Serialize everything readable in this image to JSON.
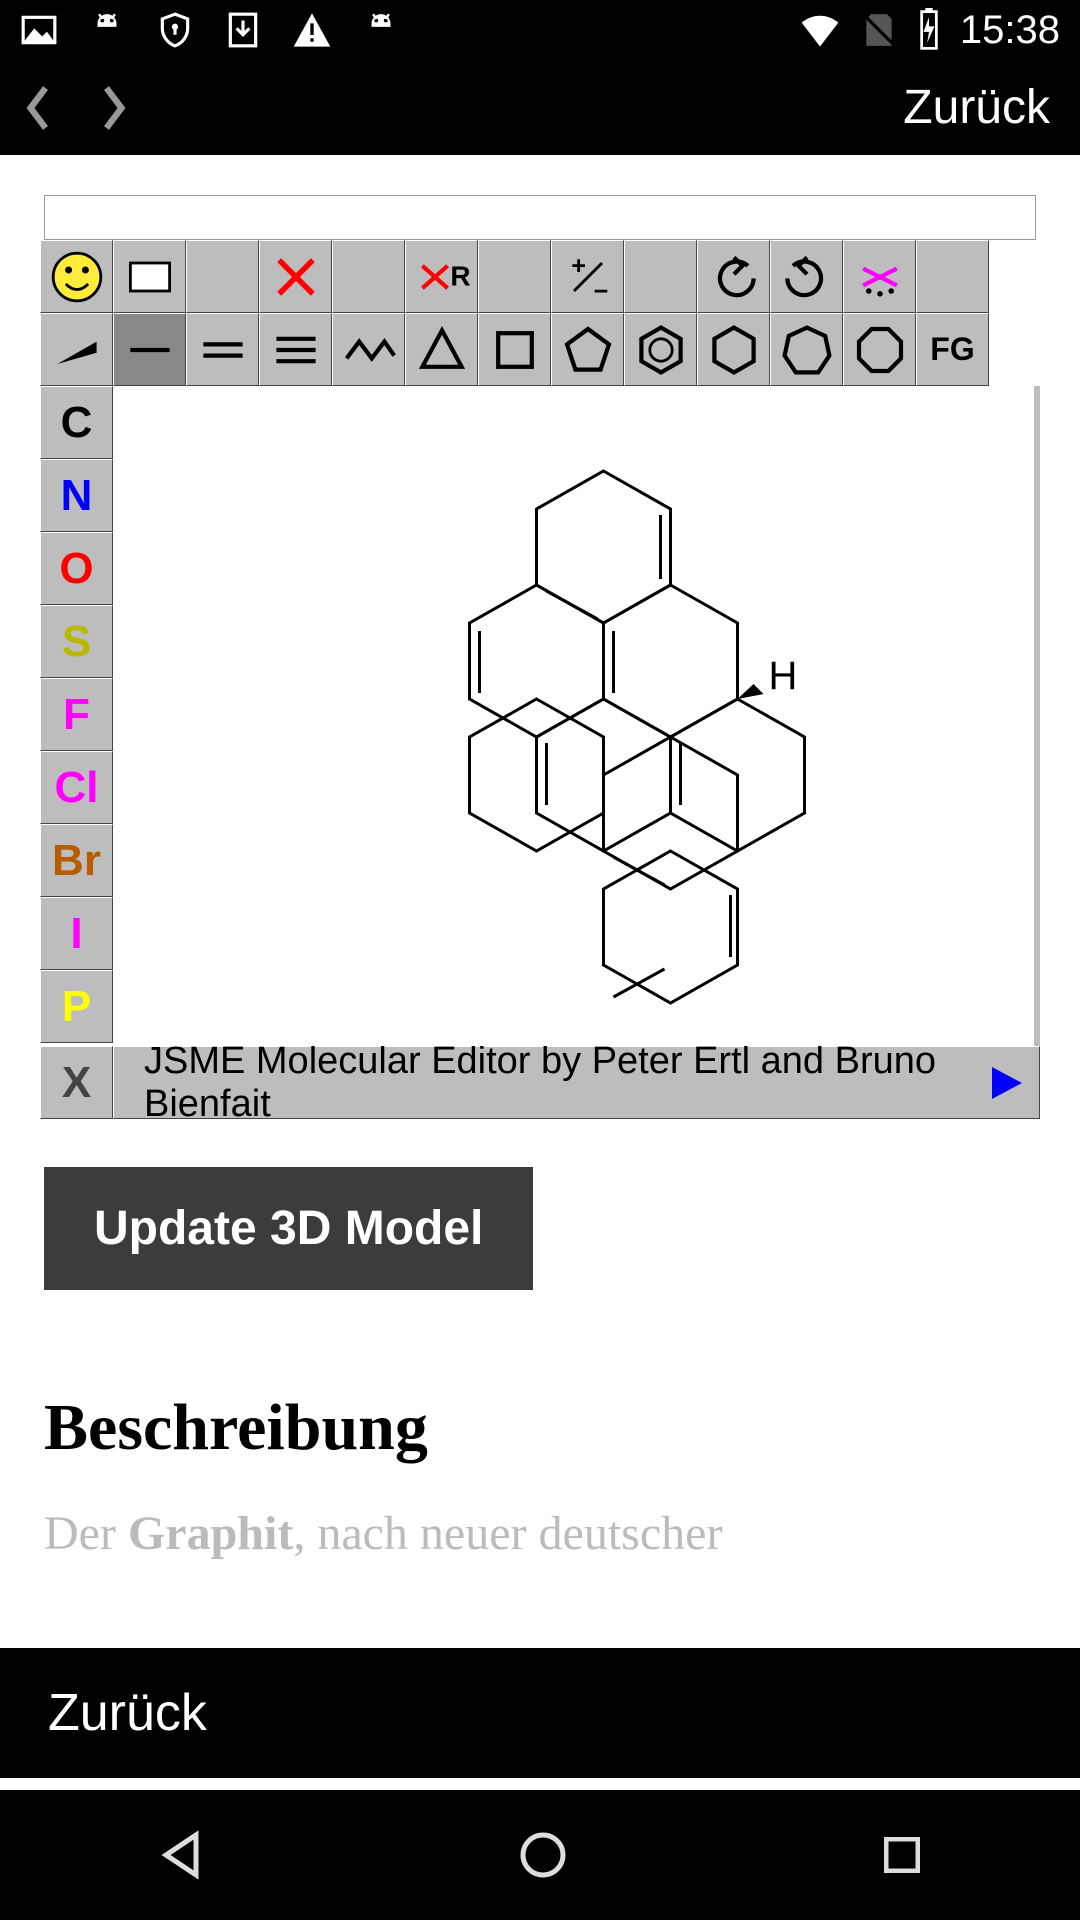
{
  "status": {
    "time": "15:38"
  },
  "top_nav": {
    "back": "Zurück"
  },
  "editor": {
    "row1": [
      {
        "name": "smiley-icon",
        "glyph": "smiley"
      },
      {
        "name": "new-page-icon",
        "glyph": "rect"
      },
      {
        "name": "blank1-icon",
        "glyph": ""
      },
      {
        "name": "delete-icon",
        "glyph": "redx"
      },
      {
        "name": "blank2-icon",
        "glyph": ""
      },
      {
        "name": "delete-r-icon",
        "glyph": "redxr"
      },
      {
        "name": "blank3-icon",
        "glyph": ""
      },
      {
        "name": "charge-icon",
        "glyph": "plusminus"
      },
      {
        "name": "blank4-icon",
        "glyph": ""
      },
      {
        "name": "undo-icon",
        "glyph": "undo"
      },
      {
        "name": "redo-icon",
        "glyph": "redo"
      },
      {
        "name": "star-icon",
        "glyph": "pinkstar"
      },
      {
        "name": "blank5-icon",
        "glyph": ""
      }
    ],
    "row2": [
      {
        "name": "wedge-icon",
        "glyph": "wedge"
      },
      {
        "name": "single-bond-icon",
        "glyph": "line1",
        "active": true
      },
      {
        "name": "double-bond-icon",
        "glyph": "line2"
      },
      {
        "name": "triple-bond-icon",
        "glyph": "line3"
      },
      {
        "name": "chain-icon",
        "glyph": "chain"
      },
      {
        "name": "ring3-icon",
        "glyph": "ring3"
      },
      {
        "name": "ring4-icon",
        "glyph": "ring4"
      },
      {
        "name": "ring5-icon",
        "glyph": "ring5"
      },
      {
        "name": "benzene-icon",
        "glyph": "benzene"
      },
      {
        "name": "ring6-icon",
        "glyph": "ring6"
      },
      {
        "name": "ring7-icon",
        "glyph": "ring7"
      },
      {
        "name": "ring8-icon",
        "glyph": "ring8"
      },
      {
        "name": "fg-icon",
        "label": "FG"
      }
    ],
    "elements": [
      {
        "label": "C",
        "color": "#000"
      },
      {
        "label": "N",
        "color": "#0000ff"
      },
      {
        "label": "O",
        "color": "#ff0000"
      },
      {
        "label": "S",
        "color": "#b8b800"
      },
      {
        "label": "F",
        "color": "#ff00ff"
      },
      {
        "label": "Cl",
        "color": "#ff00ff"
      },
      {
        "label": "Br",
        "color": "#b85c00"
      },
      {
        "label": "I",
        "color": "#ff00ff"
      },
      {
        "label": "P",
        "color": "#ffff00"
      }
    ],
    "x_label": "X",
    "credit": "JSME Molecular Editor by Peter Ertl and Bruno Bienfait",
    "molecule_h_label": "H"
  },
  "update_button": "Update 3D Model",
  "description": {
    "heading": "Beschreibung",
    "text_prefix": "Der ",
    "text_bold": "Graphit",
    "text_suffix": ", nach neuer deutscher"
  },
  "bottom_back": "Zurück"
}
